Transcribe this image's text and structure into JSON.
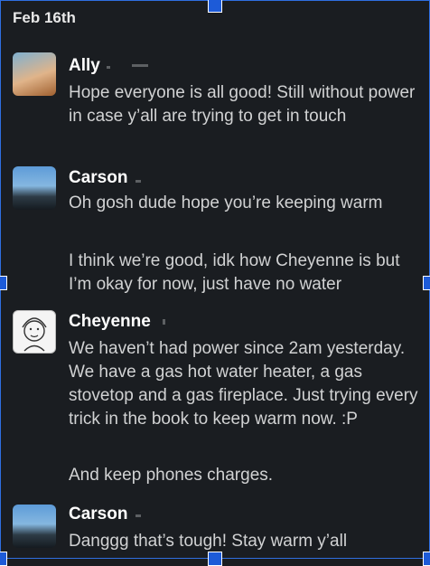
{
  "date_divider": "Feb 16th",
  "messages": [
    {
      "sender": "Ally",
      "avatar": "ally-photo",
      "lines": [
        "Hope everyone is all good! Still without power in case y’all are trying to get in touch"
      ]
    },
    {
      "sender": "Carson",
      "avatar": "carson-photo",
      "lines": [
        "Oh gosh dude hope you’re keeping warm",
        "I think we’re good, idk how Cheyenne is but I’m okay for now, just have no water"
      ]
    },
    {
      "sender": "Cheyenne",
      "avatar": "cheyenne-drawing",
      "lines": [
        "We haven’t had power since 2am yesterday. We have a gas hot water heater, a gas stovetop and a gas fireplace. Just trying every trick in the book to keep warm now. :P",
        "And keep phones charges."
      ]
    },
    {
      "sender": "Carson",
      "avatar": "carson-photo",
      "lines": [
        "Danggg that’s tough! Stay warm y’all"
      ]
    }
  ]
}
